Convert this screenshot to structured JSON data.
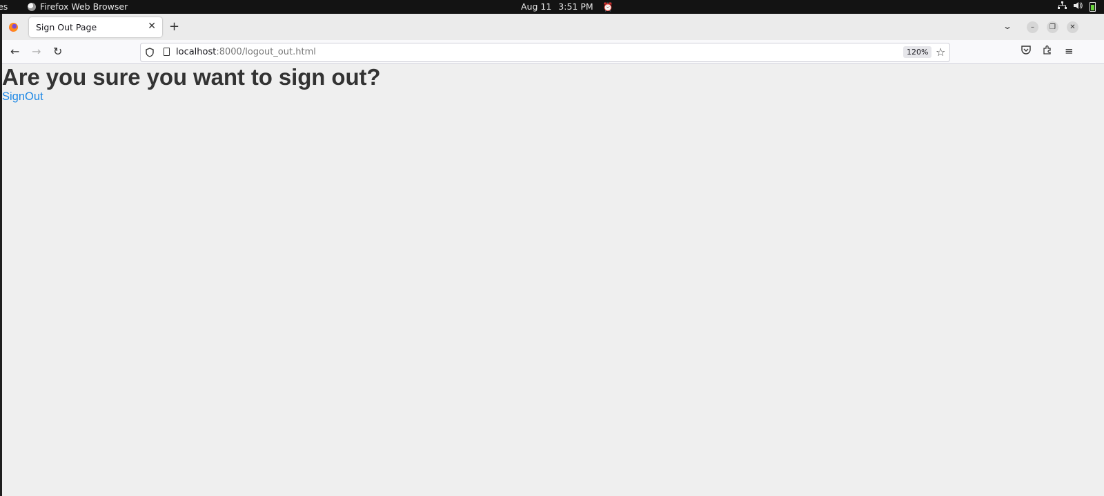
{
  "system_bar": {
    "activities_label": "es",
    "app_name": "Firefox Web Browser",
    "date": "Aug 11",
    "time": "3:51 PM"
  },
  "browser": {
    "tab": {
      "title": "Sign Out Page"
    },
    "url": {
      "host": "localhost",
      "rest": ":8000/logout_out.html"
    },
    "zoom": "120%"
  },
  "page": {
    "heading": "Are you sure you want to sign out?",
    "link_label": "SignOut"
  },
  "colors": {
    "page_background": "#efefef",
    "heading": "#333333",
    "link": "#1e88e5"
  }
}
